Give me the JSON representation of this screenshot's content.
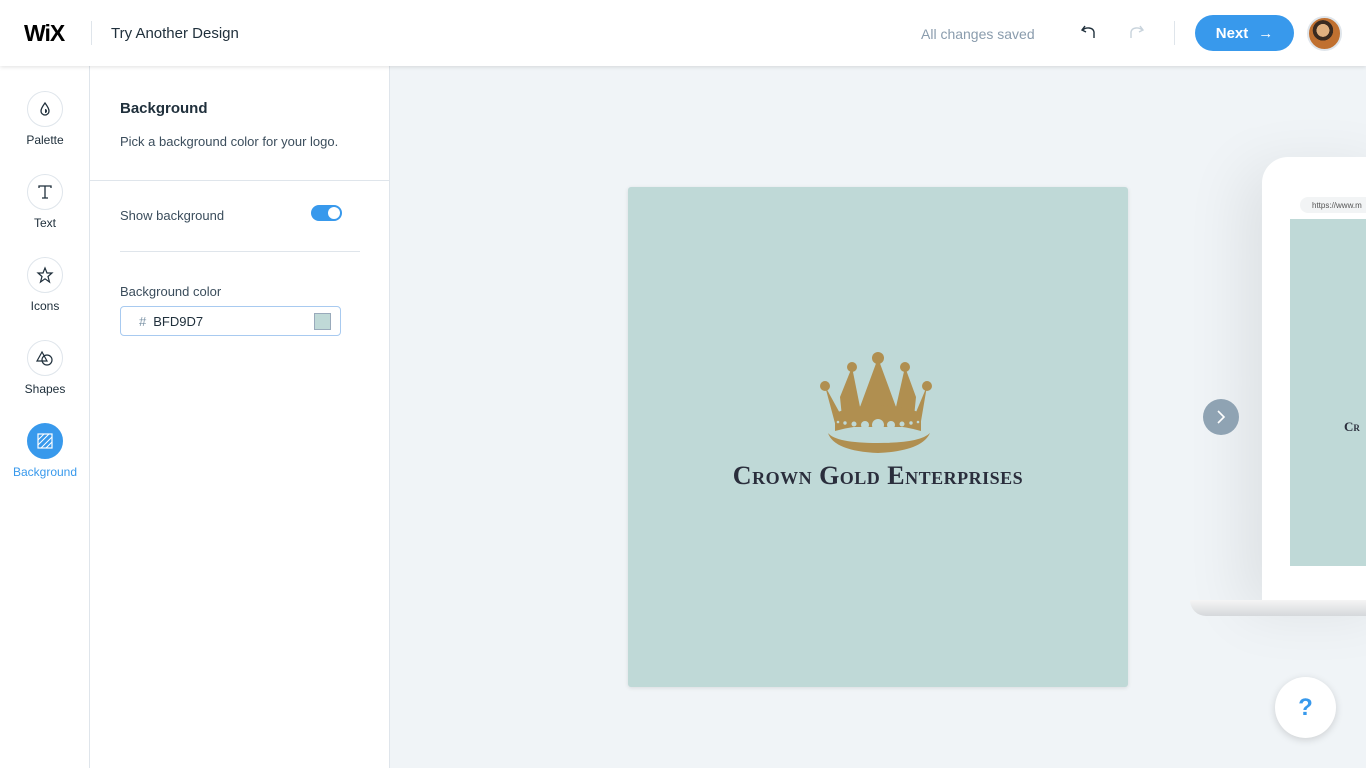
{
  "header": {
    "logo": "WiX",
    "title": "Try Another Design",
    "status": "All changes saved",
    "next_label": "Next",
    "accent": "#3899ec"
  },
  "rail": {
    "items": [
      {
        "label": "Palette",
        "icon": "drop-icon"
      },
      {
        "label": "Text",
        "icon": "text-icon"
      },
      {
        "label": "Icons",
        "icon": "star-icon"
      },
      {
        "label": "Shapes",
        "icon": "shapes-icon"
      },
      {
        "label": "Background",
        "icon": "background-icon",
        "active": true
      }
    ]
  },
  "panel": {
    "title": "Background",
    "description": "Pick a background color for your logo.",
    "show_background_label": "Show background",
    "show_background": true,
    "color_label": "Background color",
    "hash": "#",
    "color_value": "BFD9D7"
  },
  "canvas": {
    "brand": "Crown Gold Enterprises",
    "background_color": "#bfd9d7",
    "crown_color": "#b08f50"
  },
  "preview": {
    "url": "https://www.m",
    "brand_partial": "Cr"
  },
  "help_label": "?"
}
